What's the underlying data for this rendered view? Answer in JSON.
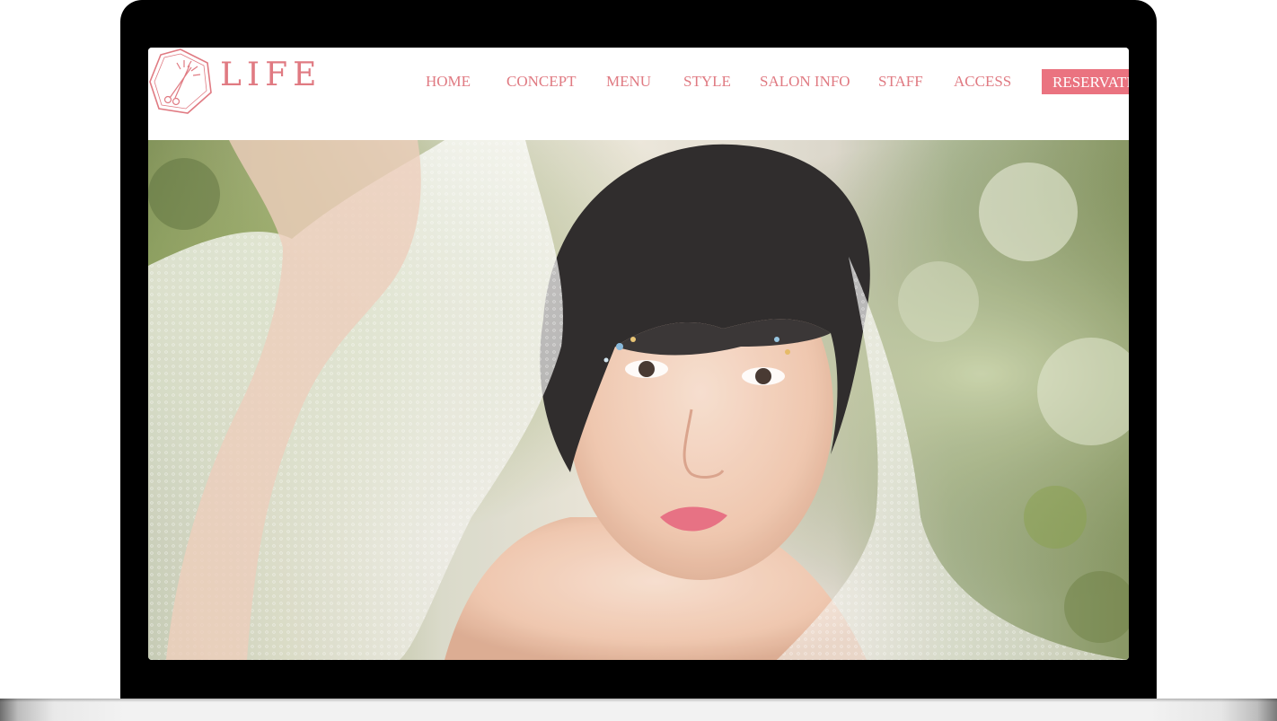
{
  "site": {
    "logo_text": "LIFE",
    "logo_icon": "scissors-comb-icon",
    "brand_color": "#e07a82",
    "accent_color": "#ea7380"
  },
  "nav": {
    "items": [
      {
        "label": "HOME"
      },
      {
        "label": "CONCEPT"
      },
      {
        "label": "MENU"
      },
      {
        "label": "STYLE"
      },
      {
        "label": "SALON INFO"
      },
      {
        "label": "STAFF"
      },
      {
        "label": "ACCESS"
      }
    ],
    "reservation_label": "RESERVATI"
  },
  "hero": {
    "image_subject": "portrait-photo"
  }
}
